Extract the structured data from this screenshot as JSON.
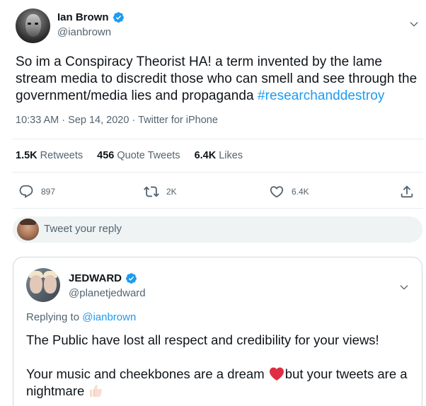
{
  "main_tweet": {
    "author": {
      "display_name": "Ian Brown",
      "handle": "@ianbrown",
      "verified": true
    },
    "text": "So im a Conspiracy Theorist HA! a term invented by the lame stream media to discredit those who can smell and see through the government/media lies and propaganda ",
    "hashtag": "#researchanddestroy",
    "timestamp": "10:33 AM · Sep 14, 2020",
    "source": "Twitter for iPhone",
    "stats": {
      "retweets_count": "1.5K",
      "retweets_label": "Retweets",
      "quotes_count": "456",
      "quotes_label": "Quote Tweets",
      "likes_count": "6.4K",
      "likes_label": "Likes"
    },
    "actions": {
      "reply_count": "897",
      "retweet_count": "2K",
      "like_count": "6.4K"
    }
  },
  "composer": {
    "placeholder": "Tweet your reply"
  },
  "reply_tweet": {
    "author": {
      "display_name": "JEDWARD",
      "handle": "@planetjedward",
      "verified": true
    },
    "replying_label": "Replying to",
    "replying_to": "@ianbrown",
    "paragraph1": "The Public have lost all respect and credibility for your views!",
    "paragraph2_part1": "Your music and cheekbones are a dream ",
    "paragraph2_part2": "but your tweets are a nightmare "
  },
  "colors": {
    "accent": "#1d9bf0",
    "text_primary": "#0f1419",
    "text_secondary": "#536471",
    "divider": "#e6ecf0",
    "composer_bg": "#eff3f4",
    "heart_emoji": "#dd2e44"
  },
  "icons": {
    "verified": "verified-badge-icon",
    "more": "chevron-down-icon",
    "reply": "reply-bubble-icon",
    "retweet": "retweet-icon",
    "like": "heart-icon",
    "share": "share-icon",
    "heart_emoji": "red-heart-emoji",
    "thumbs_emoji": "thumbs-up-emoji"
  }
}
